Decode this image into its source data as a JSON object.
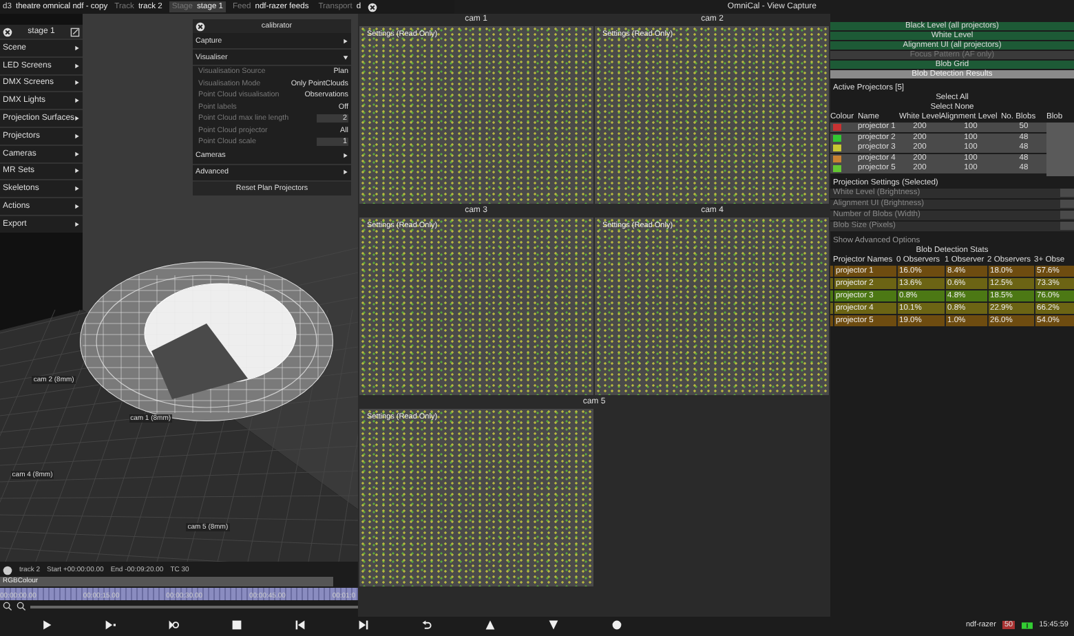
{
  "top_bar": {
    "app": "d3",
    "project": "theatre omnical ndf - copy",
    "fields": [
      {
        "label": "Track",
        "value": "track 2",
        "selected": false
      },
      {
        "label": "Stage",
        "value": "stage 1",
        "selected": true
      },
      {
        "label": "Feed",
        "value": "ndf-razer feeds",
        "selected": false
      },
      {
        "label": "Transport",
        "value": "d",
        "selected": false
      }
    ]
  },
  "viewport": {
    "camera_labels": [
      "cam 2 (8mm)",
      "cam 1 (8mm)",
      "cam 4 (8mm)",
      "cam 5 (8mm)"
    ]
  },
  "stage_menu": {
    "title": "stage 1",
    "items": [
      "Scene",
      "LED Screens",
      "DMX Screens",
      "DMX Lights",
      "Projection Surfaces",
      "Projectors",
      "Cameras",
      "MR Sets",
      "Skeletons",
      "Actions",
      "Export"
    ]
  },
  "calibrator": {
    "title": "calibrator",
    "sections": [
      {
        "label": "Capture",
        "expanded": false
      },
      {
        "label": "Visualiser",
        "expanded": true,
        "properties": [
          {
            "label": "Visualisation Source",
            "value": "Plan",
            "kind": "text"
          },
          {
            "label": "Visualisation Mode",
            "value": "Only PointClouds",
            "kind": "text"
          },
          {
            "label": "Point Cloud visualisation",
            "value": "Observations",
            "kind": "text"
          },
          {
            "label": "Point labels",
            "value": "Off",
            "kind": "text"
          },
          {
            "label": "Point Cloud max line length",
            "value": "2",
            "kind": "field"
          },
          {
            "label": "Point Cloud projector",
            "value": "All",
            "kind": "text"
          },
          {
            "label": "Point Cloud scale",
            "value": "1",
            "kind": "field"
          }
        ]
      },
      {
        "label": "Cameras",
        "expanded": false
      },
      {
        "label": "Advanced",
        "expanded": false
      }
    ],
    "button": "Reset Plan Projectors"
  },
  "capture_window": {
    "title": "OmniCal - View Capture",
    "rows": [
      {
        "headers": [
          "cam 1",
          "cam 2"
        ],
        "feeds": [
          "Settings (Read Only)",
          "Settings (Read Only)"
        ]
      },
      {
        "headers": [
          "cam 3",
          "cam 4"
        ],
        "feeds": [
          "Settings (Read Only)",
          "Settings (Read Only)"
        ]
      },
      {
        "headers": [
          "cam 5"
        ],
        "feeds": [
          "Settings (Read Only)"
        ]
      }
    ]
  },
  "right_panel": {
    "modes": [
      {
        "label": "Black Level (all projectors)",
        "selected": false,
        "disabled": false
      },
      {
        "label": "White Level",
        "selected": false,
        "disabled": false
      },
      {
        "label": "Alignment UI (all projectors)",
        "selected": false,
        "disabled": false
      },
      {
        "label": "Focus Pattern (AF only)",
        "selected": false,
        "disabled": true
      },
      {
        "label": "Blob Grid",
        "selected": false,
        "disabled": false
      },
      {
        "label": "Blob Detection Results",
        "selected": true,
        "disabled": false
      }
    ],
    "active_projectors": {
      "title": "Active Projectors [5]",
      "select_all": "Select All",
      "select_none": "Select None",
      "columns": [
        "Colour",
        "Name",
        "White Level",
        "Alignment Level",
        "No. Blobs",
        "Blob"
      ],
      "rows": [
        {
          "color": "#c83232",
          "name": "projector 1",
          "white_level": "200",
          "alignment_level": "100",
          "blobs": "50"
        },
        {
          "color": "#32c832",
          "name": "projector 2",
          "white_level": "200",
          "alignment_level": "100",
          "blobs": "48"
        },
        {
          "color": "#c8c832",
          "name": "projector 3",
          "white_level": "200",
          "alignment_level": "100",
          "blobs": "48"
        },
        {
          "color": "#c88232",
          "name": "projector 4",
          "white_level": "200",
          "alignment_level": "100",
          "blobs": "48"
        },
        {
          "color": "#64c832",
          "name": "projector 5",
          "white_level": "200",
          "alignment_level": "100",
          "blobs": "48"
        }
      ]
    },
    "projection_settings": {
      "title": "Projection Settings (Selected)",
      "fields": [
        "White Level (Brightness)",
        "Alignment UI (Brightness)",
        "Number of Blobs (Width)",
        "Blob Size (Pixels)"
      ]
    },
    "advanced": "Show Advanced Options",
    "blob_stats": {
      "title": "Blob Detection Stats",
      "columns": [
        "Projector Names",
        "0 Observers",
        "1 Observer",
        "2 Observers",
        "3+ Obse"
      ],
      "rows": [
        {
          "name": "projector 1",
          "color": "#6e4c10",
          "values": [
            "16.0%",
            "8.4%",
            "18.0%",
            "57.6%"
          ]
        },
        {
          "name": "projector 2",
          "color": "#6c6414",
          "values": [
            "13.6%",
            "0.6%",
            "12.5%",
            "73.3%"
          ]
        },
        {
          "name": "projector 3",
          "color": "#4c7814",
          "values": [
            "0.8%",
            "4.8%",
            "18.5%",
            "76.0%"
          ]
        },
        {
          "name": "projector 4",
          "color": "#6c6414",
          "values": [
            "10.1%",
            "0.8%",
            "22.9%",
            "66.2%"
          ]
        },
        {
          "name": "projector 5",
          "color": "#6e4c10",
          "values": [
            "19.0%",
            "1.0%",
            "26.0%",
            "54.0%"
          ]
        }
      ]
    }
  },
  "timeline": {
    "track": "track 2",
    "start": "Start +00:00:00.00",
    "end": "End -00:09:20.00",
    "tc": "TC 30",
    "layer": "RGBColour",
    "ruler": [
      "00:00:00.00",
      "00:00:15.00",
      "00:00:30.00",
      "00:00:45.00",
      "00:01:0"
    ]
  },
  "status": {
    "machine": "ndf-razer",
    "badge": "50",
    "time": "15:45:59"
  }
}
